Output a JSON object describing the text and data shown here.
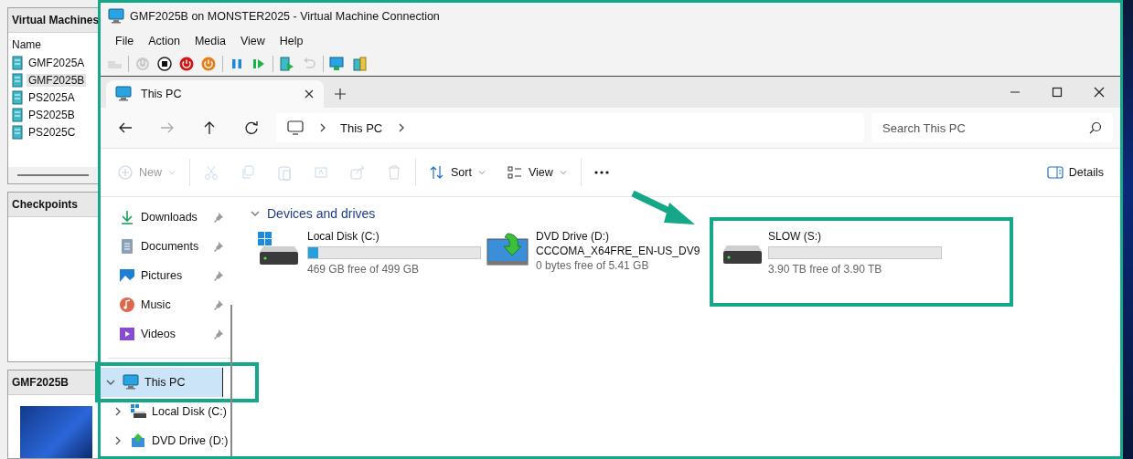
{
  "manager": {
    "vm_header": "Virtual Machines",
    "column": "Name",
    "vms": [
      {
        "name": "GMF2025A",
        "selected": false
      },
      {
        "name": "GMF2025B",
        "selected": true
      },
      {
        "name": "PS2025A",
        "selected": false
      },
      {
        "name": "PS2025B",
        "selected": false
      },
      {
        "name": "PS2025C",
        "selected": false
      }
    ],
    "checkpoints_header": "Checkpoints",
    "preview_header": "GMF2025B"
  },
  "window": {
    "title": "GMF2025B on MONSTER2025 - Virtual Machine Connection"
  },
  "menu": [
    "File",
    "Action",
    "Media",
    "View",
    "Help"
  ],
  "toolbar": [
    {
      "kind": "ctrlaltdel",
      "disabled": true
    },
    {
      "kind": "sep"
    },
    {
      "kind": "start",
      "disabled": true
    },
    {
      "kind": "turnoff",
      "disabled": false
    },
    {
      "kind": "shutdown",
      "disabled": false
    },
    {
      "kind": "save",
      "disabled": false
    },
    {
      "kind": "sep"
    },
    {
      "kind": "pause",
      "disabled": false
    },
    {
      "kind": "resume",
      "disabled": false
    },
    {
      "kind": "sep"
    },
    {
      "kind": "checkpoint",
      "disabled": false
    },
    {
      "kind": "revert",
      "disabled": true
    },
    {
      "kind": "sep"
    },
    {
      "kind": "enhanced",
      "disabled": false
    },
    {
      "kind": "share",
      "disabled": false
    }
  ],
  "explorer": {
    "tabs": [
      {
        "label": "This PC",
        "selected": true
      }
    ],
    "address": {
      "crumbs": [
        "This PC"
      ]
    },
    "nav_buttons": [
      {
        "kind": "back",
        "disabled": false
      },
      {
        "kind": "forward",
        "disabled": true
      },
      {
        "kind": "up",
        "disabled": false
      },
      {
        "kind": "refresh",
        "disabled": false
      }
    ],
    "search": {
      "placeholder": "Search This PC"
    },
    "commands": [
      {
        "kind": "new",
        "label": "New",
        "disabled": true
      },
      {
        "kind": "sep"
      },
      {
        "kind": "cut",
        "disabled": true
      },
      {
        "kind": "copy",
        "disabled": true
      },
      {
        "kind": "paste",
        "disabled": true
      },
      {
        "kind": "rename",
        "disabled": true
      },
      {
        "kind": "share",
        "disabled": true
      },
      {
        "kind": "delete",
        "disabled": true
      },
      {
        "kind": "sep"
      },
      {
        "kind": "sort",
        "label": "Sort",
        "disabled": false
      },
      {
        "kind": "view",
        "label": "View",
        "disabled": false
      },
      {
        "kind": "sep"
      },
      {
        "kind": "more",
        "disabled": false
      }
    ],
    "details": "Details",
    "nav": [
      {
        "kind": "downloads",
        "label": "Downloads",
        "pinned": true
      },
      {
        "kind": "documents",
        "label": "Documents",
        "pinned": true
      },
      {
        "kind": "pictures",
        "label": "Pictures",
        "pinned": true
      },
      {
        "kind": "music",
        "label": "Music",
        "pinned": true
      },
      {
        "kind": "videos",
        "label": "Videos",
        "pinned": true
      }
    ],
    "tree": [
      {
        "kind": "pc",
        "label": "This PC",
        "expanded": true,
        "selected": true,
        "highlighted": true,
        "children": [
          {
            "kind": "disk",
            "label": "Local Disk (C:)",
            "expanded": false,
            "selected": false,
            "highlighted": false
          },
          {
            "kind": "dvd",
            "label": "DVD Drive (D:)",
            "expanded": false,
            "selected": false,
            "highlighted": false
          }
        ]
      }
    ],
    "section": {
      "title": "Devices and drives",
      "expanded": true
    },
    "drives": [
      {
        "kind": "system",
        "name": "Local Disk (C:)",
        "level": 0.06,
        "free": "469 GB free of 499 GB",
        "highlighted": false
      },
      {
        "kind": "dvd",
        "name": "DVD Drive (D:)",
        "volume": "CCCOMA_X64FRE_EN-US_DV9",
        "free": "0 bytes free of 5.41 GB",
        "highlighted": false
      },
      {
        "kind": "disk",
        "name": "SLOW (S:)",
        "level": 0,
        "free": "3.90 TB free of 3.90 TB",
        "highlighted": true
      }
    ]
  }
}
